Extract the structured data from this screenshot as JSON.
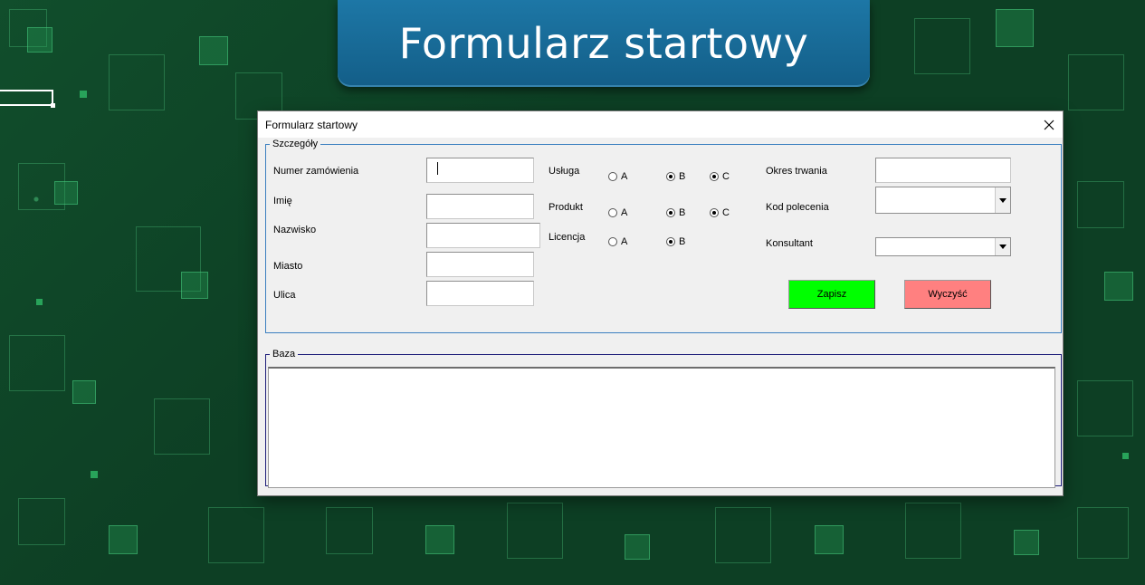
{
  "banner": {
    "title": "Formularz startowy"
  },
  "dialog": {
    "title": "Formularz startowy",
    "details": {
      "legend": "Szczegóły",
      "fields": {
        "order_number": {
          "label": "Numer zamówienia",
          "value": ""
        },
        "first_name": {
          "label": "Imię",
          "value": ""
        },
        "last_name": {
          "label": "Nazwisko",
          "value": ""
        },
        "city": {
          "label": "Miasto",
          "value": ""
        },
        "street": {
          "label": "Ulica",
          "value": ""
        }
      },
      "options": {
        "service": {
          "label": "Usługa",
          "choices": [
            "A",
            "B",
            "C"
          ],
          "checked": [
            "B",
            "C"
          ]
        },
        "product": {
          "label": "Produkt",
          "choices": [
            "A",
            "B",
            "C"
          ],
          "checked": [
            "B",
            "C"
          ]
        },
        "license": {
          "label": "Licencja",
          "choices": [
            "A",
            "B"
          ],
          "checked": [
            "B"
          ]
        }
      },
      "right": {
        "duration": {
          "label": "Okres trwania",
          "value": ""
        },
        "referral_code": {
          "label": "Kod polecenia",
          "value": ""
        },
        "consultant": {
          "label": "Konsultant",
          "value": ""
        }
      },
      "buttons": {
        "save": {
          "label": "Zapisz",
          "color": "#00ff00"
        },
        "clear": {
          "label": "Wyczyść",
          "color": "#ff8080"
        }
      }
    },
    "base": {
      "legend": "Baza"
    }
  },
  "colors": {
    "background": "#0d3f24",
    "banner": "#1a6f9b",
    "frame_border": "#3b7fc0"
  }
}
